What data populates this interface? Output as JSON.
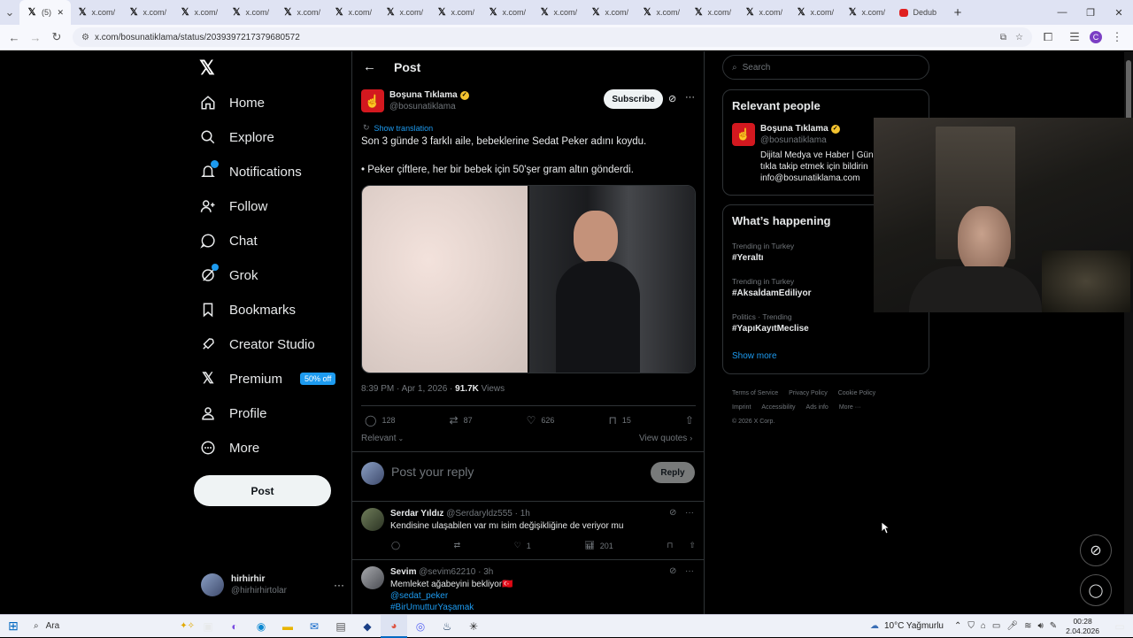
{
  "browser": {
    "tabs": [
      "(5)",
      "x.com/",
      "x.com/",
      "x.com/",
      "x.com/",
      "x.com/",
      "x.com/",
      "x.com/",
      "x.com/",
      "x.com/",
      "x.com/",
      "x.com/",
      "x.com/",
      "x.com/",
      "x.com/",
      "x.com/",
      "x.com/",
      "Dedub"
    ],
    "url": "x.com/bosunatiklama/status/2039397217379680572",
    "profile_initial": "C"
  },
  "nav": {
    "items": [
      "Home",
      "Explore",
      "Notifications",
      "Follow",
      "Chat",
      "Grok",
      "Bookmarks",
      "Creator Studio",
      "Premium",
      "Profile",
      "More"
    ],
    "premium_badge": "50% off",
    "post_button": "Post"
  },
  "account": {
    "name": "hirhirhir",
    "handle": "@hirhirhirtolar"
  },
  "main": {
    "title": "Post",
    "author": {
      "name": "Boşuna Tıklama",
      "handle": "@bosunatiklama"
    },
    "subscribe": "Subscribe",
    "show_translation": "Show translation",
    "text1": "Son 3 günde 3 farklı aile, bebeklerine Sedat Peker adını koydu.",
    "text2": "• Peker çiftlere, her bir bebek için 50'şer gram altın gönderdi.",
    "meta_time": "8:39 PM · Apr 1, 2026 ·",
    "views_count": "91.7K",
    "views_label": "Views",
    "stats": {
      "replies": "128",
      "reposts": "87",
      "likes": "626",
      "bookmarks": "15"
    },
    "relevant": "Relevant",
    "view_quotes": "View quotes",
    "reply_placeholder": "Post your reply",
    "reply_button": "Reply",
    "replies": [
      {
        "name": "Serdar Yıldız",
        "handle": "@Serdaryldz555",
        "time": "· 1h",
        "text": "Kendisine ulaşabilen var mı isim değişikliğine de veriyor mu",
        "likes": "1",
        "views": "201"
      },
      {
        "name": "Sevim",
        "handle": "@sevim62210",
        "time": "· 3h",
        "text": "Memleket ağabeyini bekliyor🇹🇷",
        "mention": "@sedat_peker",
        "hashtag": "#BirUmutturYaşamak"
      }
    ]
  },
  "right": {
    "search_placeholder": "Search",
    "relevant_people_title": "Relevant people",
    "person": {
      "name": "Boşuna Tıklama",
      "handle": "@bosunatiklama",
      "bio1": "Dijital Medya ve Haber | Gün",
      "bio2": "tıkla takip etmek için bildirin",
      "bio3": "info@bosunatiklama.com"
    },
    "happening_title": "What’s happening",
    "trends": [
      {
        "context": "Trending in Turkey",
        "tag": "#Yeraltı"
      },
      {
        "context": "Trending in Turkey",
        "tag": "#AksaİdamEdiliyor"
      },
      {
        "context": "Politics · Trending",
        "tag": "#YapıKayıtMeclise"
      }
    ],
    "show_more": "Show more",
    "footer1": [
      "Terms of Service",
      "Privacy Policy",
      "Cookie Policy"
    ],
    "footer2": [
      "Imprint",
      "Accessibility",
      "Ads info",
      "More ···"
    ],
    "copyright": "© 2026 X Corp."
  },
  "taskbar": {
    "search": "Ara",
    "weather": "10°C  Yağmurlu",
    "time": "00:28",
    "date": "2.04.2026"
  },
  "colors": {
    "accent": "#1d9bf0",
    "verified": "#f4c430",
    "brand_red": "#d3181f"
  }
}
